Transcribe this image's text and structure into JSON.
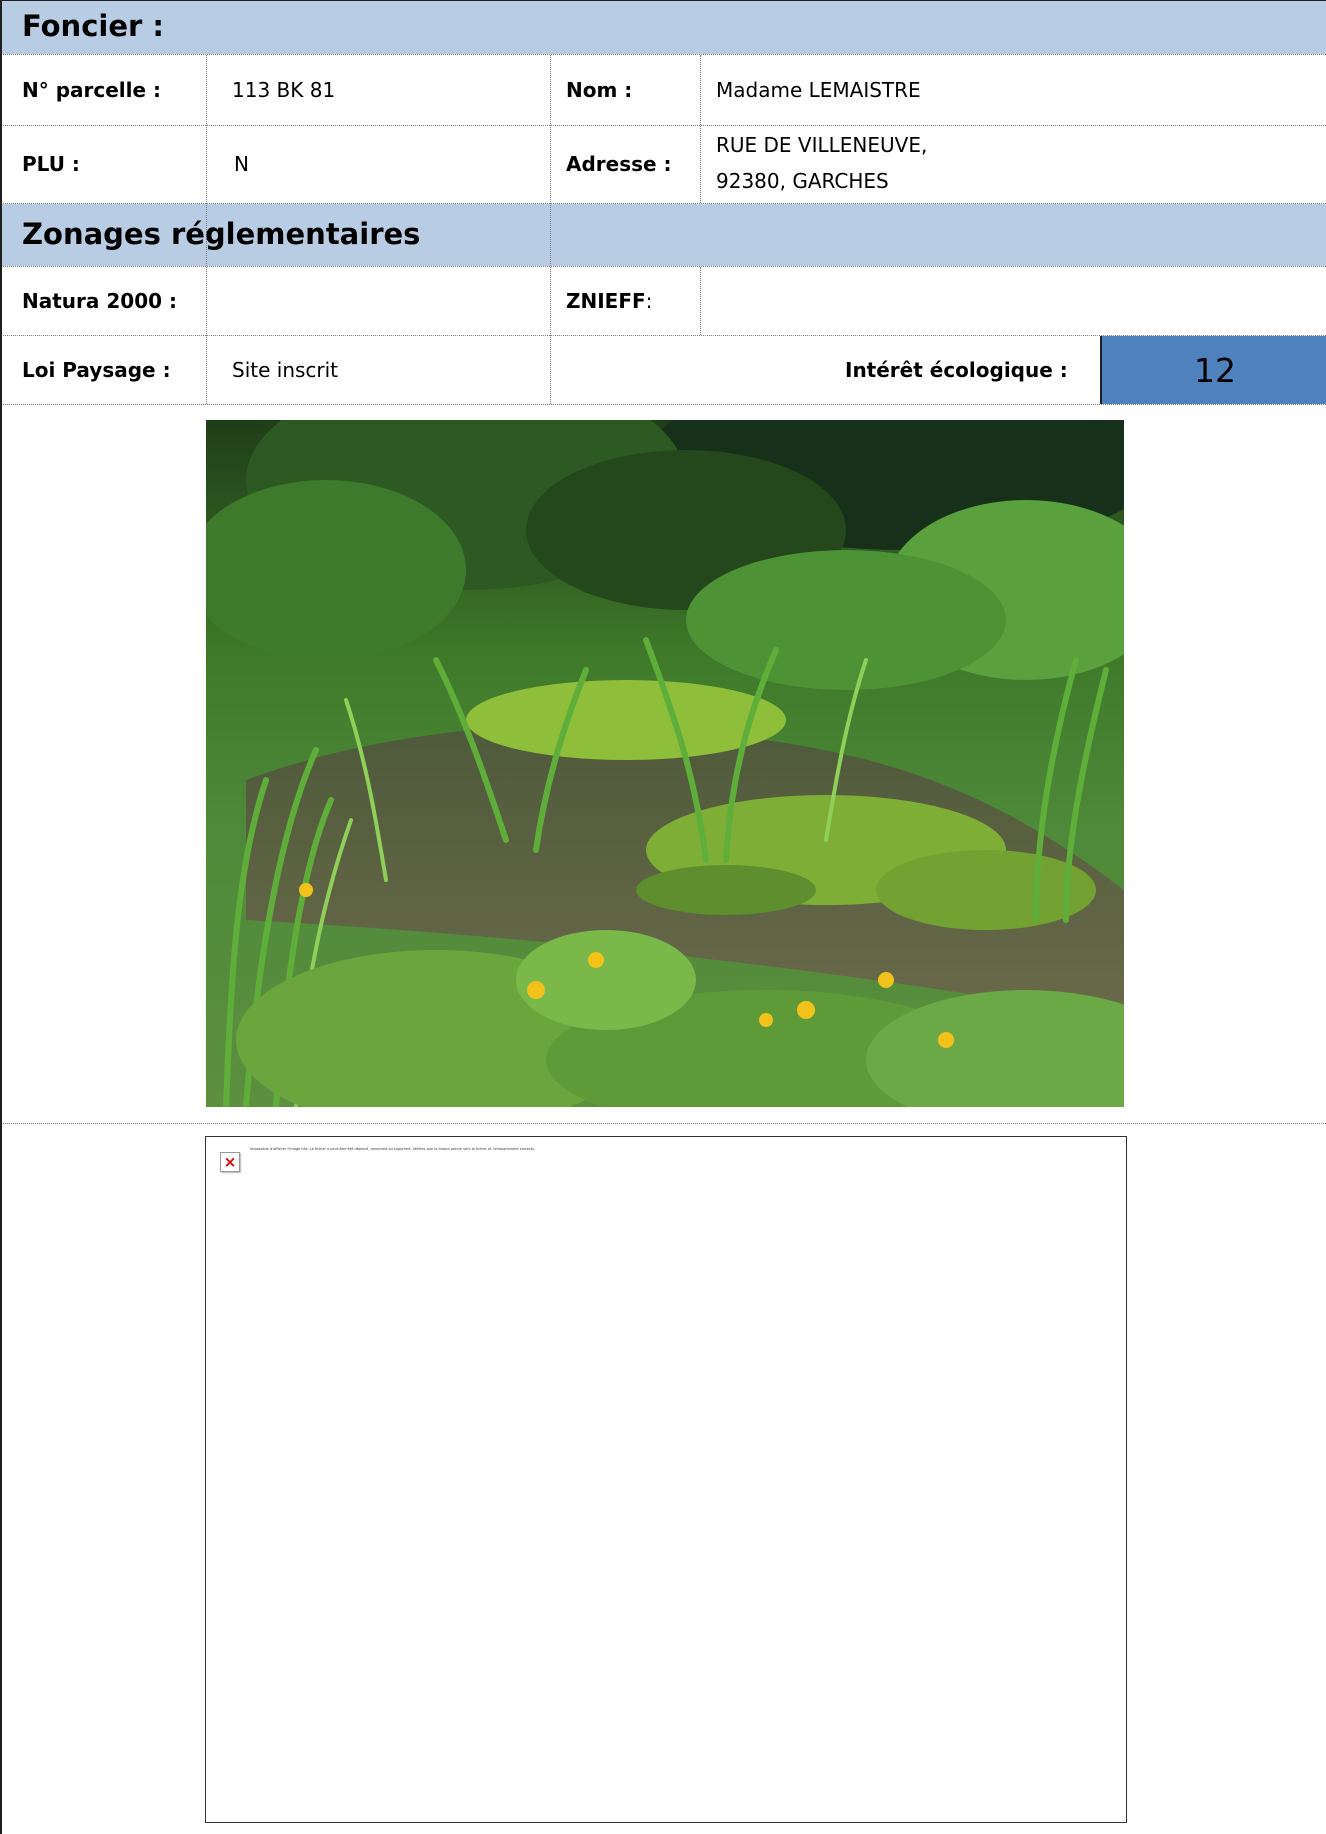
{
  "foncier": {
    "title": "Foncier :",
    "parcelle_label": "N° parcelle :",
    "parcelle_value": "113 BK 81",
    "nom_label": "Nom :",
    "nom_value": "Madame LEMAISTRE",
    "plu_label": "PLU :",
    "plu_value": "N",
    "adresse_label": "Adresse :",
    "adresse_line1": "RUE DE VILLENEUVE,",
    "adresse_line2": "92380, GARCHES"
  },
  "zonages": {
    "title": "Zonages réglementaires",
    "natura_label": "Natura 2000 :",
    "natura_value": "",
    "znieff_label": "ZNIEFF",
    "znieff_colon": " :",
    "znieff_value": "",
    "loi_paysage_label": "Loi Paysage :",
    "loi_paysage_value": "Site inscrit",
    "interet_label": "Intérêt écologique :",
    "interet_value": "12"
  },
  "photo": {
    "icon": "pond-photo"
  },
  "broken_image": {
    "icon": "broken-image-icon",
    "glyph": "×",
    "message": "Impossible d'afficher l'image liée. Le fichier a peut-être été déplacé, renommé ou supprimé. Vérifiez que la liaison pointe vers le fichier et l'emplacement corrects."
  },
  "colors": {
    "band": "#b8cce4",
    "score": "#4f81bd"
  }
}
